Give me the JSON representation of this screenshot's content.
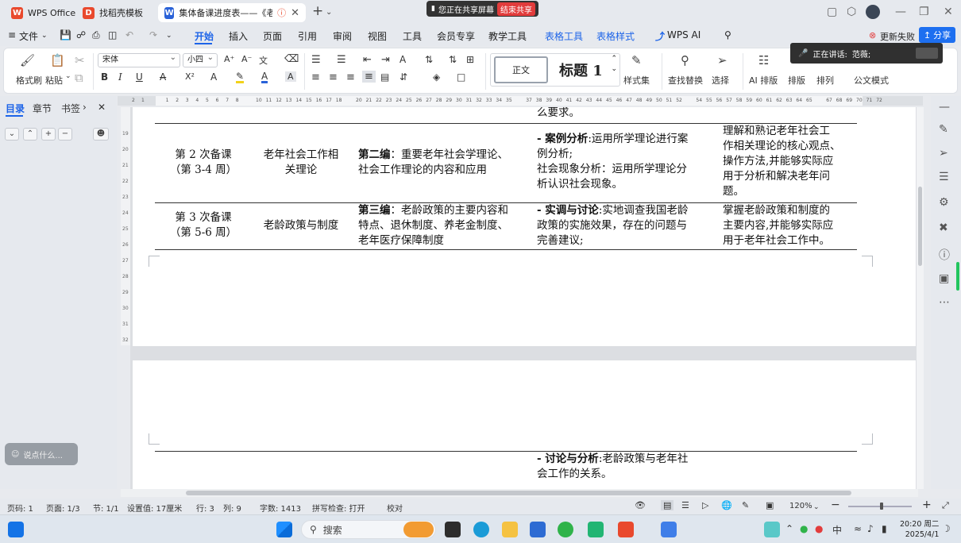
{
  "titlebar": {
    "tabs": [
      {
        "label": "WPS Office",
        "logo": "W",
        "logo_color": "#e9492d"
      },
      {
        "label": "找稻壳模板",
        "logo": "D",
        "logo_color": "#e9492d"
      },
      {
        "label": "集体备课进度表——《老年社",
        "logo": "W",
        "logo_color": "#2a62d8",
        "active": true
      }
    ],
    "new_tab": "+",
    "share_notice": "您正在共享屏幕",
    "share_end": "结束共享"
  },
  "menubar": {
    "file": "文件",
    "items": [
      "开始",
      "插入",
      "页面",
      "引用",
      "审阅",
      "视图",
      "工具",
      "会员专享",
      "教学工具",
      "表格工具",
      "表格样式",
      "WPS AI"
    ],
    "update_fail": "更新失败",
    "share": "分享"
  },
  "ribbon": {
    "format_painter": "格式刷",
    "paste": "粘贴",
    "font_name": "宋体",
    "font_size": "小四",
    "style_normal": "正文",
    "style_h1": "标题 1",
    "style_set": "样式集",
    "find_replace": "查找替换",
    "select": "选择",
    "ai_layout": "AI 排版",
    "layout": "排版",
    "arrange": "排列",
    "official_mode": "公文模式"
  },
  "speaking": {
    "label": "正在讲话:",
    "name": "范薇;"
  },
  "navpane": {
    "tabs": [
      "目录",
      "章节",
      "书签"
    ],
    "comment_placeholder": "说点什么..."
  },
  "ruler": {
    "left_marks": [
      "2",
      "1"
    ],
    "marks": [
      "1",
      "2",
      "3",
      "4",
      "5",
      "6",
      "7",
      "8",
      "10",
      "11",
      "12",
      "13",
      "14",
      "15",
      "16",
      "17",
      "18",
      "20",
      "21",
      "22",
      "23",
      "24",
      "25",
      "26",
      "27",
      "28",
      "29",
      "30",
      "31",
      "32",
      "33",
      "34",
      "35",
      "37",
      "38",
      "39",
      "40",
      "41",
      "42",
      "43",
      "44",
      "45",
      "46",
      "47",
      "48",
      "49",
      "50",
      "51",
      "52",
      "54",
      "55",
      "56",
      "57",
      "58",
      "59",
      "60",
      "61",
      "62",
      "63",
      "64",
      "65",
      "67",
      "68",
      "69",
      "70",
      "71",
      "72"
    ],
    "vmarks": [
      "19",
      "20",
      "21",
      "22",
      "23",
      "24",
      "25",
      "26",
      "27",
      "28",
      "29",
      "30",
      "31",
      "32"
    ]
  },
  "document": {
    "top_fragment": "么要求。",
    "rows": [
      {
        "session": "第 2 次备课",
        "weeks": "（第 3-4 周）",
        "topic": [
          "老年社会工作相",
          "关理论"
        ],
        "content_bold": "第二编",
        "content_lines": [
          "：重要老年社会学理论、",
          "社会工作理论的内容和应用"
        ],
        "method_bold": "- 案例分析",
        "method_lines": [
          ":运用所学理论进行案",
          "例分析;",
          "社会现象分析：运用所学理论分",
          "析认识社会现象。"
        ],
        "goal_lines": [
          "理解和熟记老年社会工",
          "作相关理论的核心观点、",
          "操作方法,并能够实际应",
          "用于分析和解决老年问",
          "题。"
        ]
      },
      {
        "session": "第 3 次备课",
        "weeks": "（第 5-6 周）",
        "topic": [
          "老龄政策与制度"
        ],
        "content_bold": "第三编",
        "content_lines": [
          "：老龄政策的主要内容和",
          "特点、退休制度、养老金制度、",
          "老年医疗保障制度"
        ],
        "method_bold": "- 实调与讨论",
        "method_lines": [
          ":实地调查我国老龄",
          "政策的实施效果，存在的问题与",
          "完善建议;"
        ],
        "goal_lines": [
          "掌握老龄政策和制度的",
          "主要内容,并能够实际应",
          "用于老年社会工作中。"
        ]
      }
    ],
    "page2_bold": "- 讨论与分析",
    "page2_lines": [
      ":老龄政策与老年社",
      "会工作的关系。"
    ]
  },
  "statusbar": {
    "page_num": "页码: 1",
    "pages": "页面: 1/3",
    "section": "节: 1/1",
    "position": "设置值: 17厘米",
    "row": "行: 3",
    "col": "列: 9",
    "words": "字数: 1413",
    "spell": "拼写检查: 打开",
    "proof": "校对",
    "zoom": "120%"
  },
  "taskbar": {
    "search": "搜索",
    "ime": "中",
    "time": "20:20 周二",
    "date": "2025/4/1"
  }
}
